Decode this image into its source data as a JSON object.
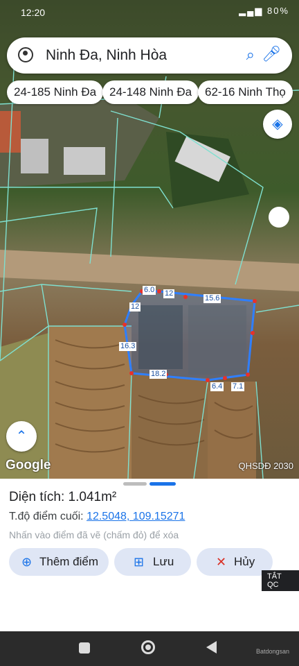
{
  "status": {
    "time": "12:20",
    "battery": "80%"
  },
  "search": {
    "query": "Ninh Đa, Ninh Hòa"
  },
  "chips": [
    "24-185 Ninh Đa",
    "24-148 Ninh Đa",
    "62-16 Ninh Thọ"
  ],
  "map": {
    "segment_labels": [
      "6.0",
      "12",
      "15.6",
      "12",
      "16.3",
      "18.2",
      "6.4",
      "7.1"
    ],
    "watermark": "Google",
    "layer_label": "QHSDĐ 2030",
    "colors": {
      "parcel_lines": "#7fe0d0",
      "polygon": "#2f7fff",
      "vertex": "#e8312a"
    }
  },
  "sheet": {
    "area_label": "Diện tích:",
    "area_value": "1.041m²",
    "coord_label": "T.độ điểm cuối:",
    "coord_value": "12.5048, 109.15271",
    "hint": "Nhấn vào điểm đã vẽ (chấm đỏ) để xóa",
    "buttons": {
      "add": "Thêm điểm",
      "save": "Lưu",
      "cancel": "Hủy"
    },
    "ad_tag": "TẮT QC"
  },
  "footer": {
    "brand": "Batdongsan"
  }
}
